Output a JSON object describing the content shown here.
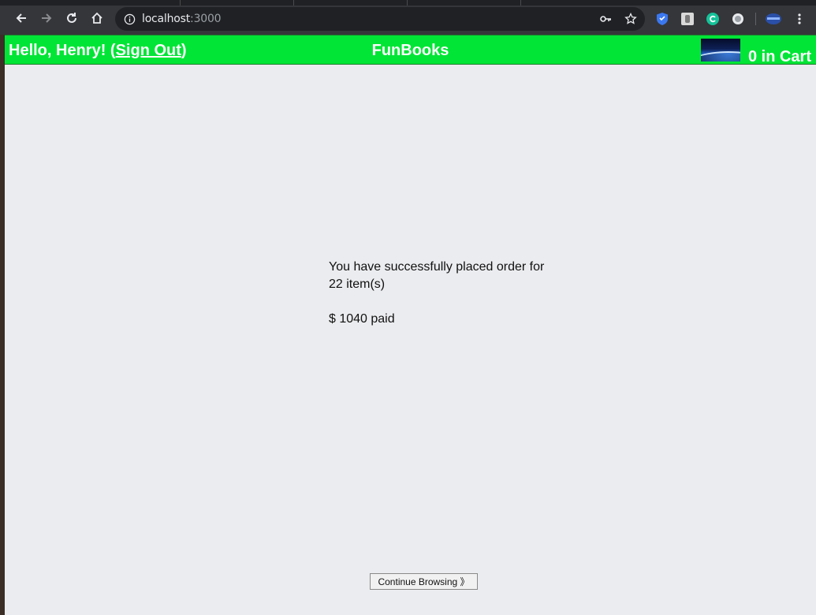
{
  "browser": {
    "url_host": "localhost",
    "url_port": ":3000"
  },
  "header": {
    "greeting": "Hello, Henry!",
    "sign_out_open": " (",
    "sign_out_label": "Sign Out",
    "sign_out_close": ")",
    "brand": "FunBooks",
    "cart_count": "0 in Cart"
  },
  "order": {
    "message": "You have successfully placed order for 22 item(s)",
    "paid": "$ 1040 paid"
  },
  "actions": {
    "continue_label": "Continue Browsing 》"
  },
  "colors": {
    "header_bg": "#00e536",
    "page_bg": "#ebecef"
  }
}
